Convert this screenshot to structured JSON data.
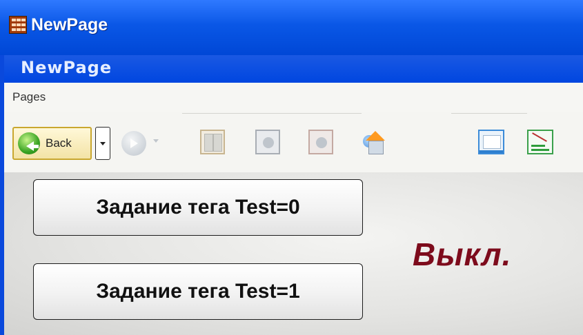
{
  "window": {
    "title": "NewPage",
    "app_icon": "hmi-app-icon"
  },
  "header": {
    "page_name": "NewPage"
  },
  "menu": {
    "label": "Pages"
  },
  "toolbar": {
    "back_label": "Back",
    "icons": [
      "back-icon",
      "dropdown-icon",
      "forward-icon",
      "pages-icon",
      "prev-page-icon",
      "next-page-icon",
      "home-icon",
      "screen-icon",
      "trend-icon"
    ]
  },
  "main": {
    "button_set_0": "Задание тега Test=0",
    "button_set_1": "Задание тега Test=1",
    "status_text": "Выкл.",
    "status_color": "#7d0b1c"
  }
}
